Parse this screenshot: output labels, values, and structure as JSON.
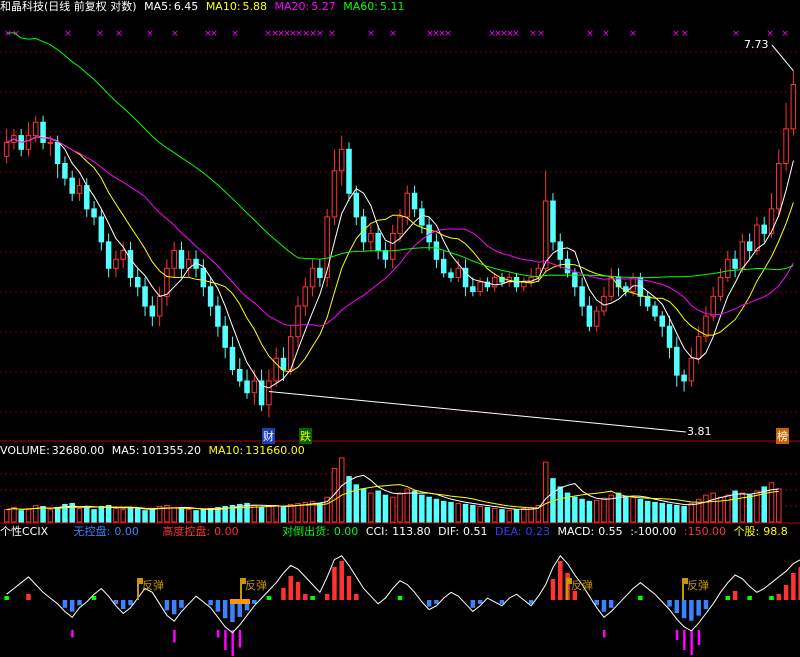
{
  "price_header": {
    "title": "和晶科技(日线 前复权 对数)",
    "ma5_label": "MA5:",
    "ma5_value": "6.45",
    "ma10_label": "MA10:",
    "ma10_value": "5.88",
    "ma20_label": "MA20:",
    "ma20_value": "5.27",
    "ma60_label": "MA60:",
    "ma60_value": "5.11"
  },
  "volume_header": {
    "volume_label": "VOLUME:",
    "volume_value": "32680.00",
    "ma5_label": "MA5:",
    "ma5_value": "101355.20",
    "ma10_label": "MA10:",
    "ma10_value": "131660.00"
  },
  "indicator_header": {
    "name": "个性CCIX",
    "no_control_label": "无控盘:",
    "no_control_value": "0.00",
    "high_control_label": "高度控盘:",
    "high_control_value": "0.00",
    "dump_label": "对倒出货:",
    "dump_value": "0.00",
    "cci_label": "CCI:",
    "cci_value": "113.80",
    "dif_label": "DIF:",
    "dif_value": "0.51",
    "dea_label": "DEA:",
    "dea_value": "0.23",
    "macd_label": "MACD:",
    "macd_value": "0.55",
    "neg100": ":-100.00",
    "pos150": ":150.00",
    "stock_label": "个股:",
    "stock_value": "98.8"
  },
  "annotations": {
    "high_price": "7.73",
    "low_price": "3.81",
    "tag_cai": "财",
    "tag_die": "跌",
    "tag_bang": "榜",
    "rebound": "反弹"
  },
  "colors": {
    "up": "#ff3232",
    "down": "#54ffff",
    "ma5": "#ffffff",
    "ma10": "#ffff00",
    "ma20": "#ff00ff",
    "ma60": "#00ff00",
    "grid": "#800000",
    "panel_border": "#b40000",
    "rebound": "#c89600",
    "cci_line": "#ffffff",
    "neg_bar": "#3c82ff",
    "magenta_bar": "#ff00ff"
  },
  "chart_data": [
    {
      "type": "candlestick",
      "title": "和晶科技(日线 前复权 对数)",
      "ylabel": "",
      "ylim": [
        3.5,
        8.2
      ],
      "log_scale": true,
      "annotations": {
        "high": 7.73,
        "low": 3.81
      },
      "series": [
        {
          "name": "MA5",
          "last": 6.45
        },
        {
          "name": "MA10",
          "last": 5.88
        },
        {
          "name": "MA20",
          "last": 5.27
        },
        {
          "name": "MA60",
          "last": 5.11
        }
      ],
      "candles": [
        [
          6.4,
          6.6,
          6.8,
          6.3
        ],
        [
          6.6,
          6.7,
          6.8,
          6.5
        ],
        [
          6.7,
          6.5,
          6.8,
          6.4
        ],
        [
          6.5,
          6.7,
          6.9,
          6.4
        ],
        [
          6.7,
          6.9,
          7.0,
          6.6
        ],
        [
          6.9,
          6.6,
          7.0,
          6.5
        ],
        [
          6.6,
          6.6,
          6.7,
          6.4
        ],
        [
          6.6,
          6.3,
          6.7,
          6.1
        ],
        [
          6.3,
          6.1,
          6.4,
          6.0
        ],
        [
          6.1,
          5.9,
          6.2,
          5.8
        ],
        [
          5.9,
          6.0,
          6.1,
          5.8
        ],
        [
          6.0,
          5.7,
          6.1,
          5.6
        ],
        [
          5.7,
          5.6,
          5.8,
          5.5
        ],
        [
          5.6,
          5.3,
          5.7,
          5.2
        ],
        [
          5.3,
          5.0,
          5.4,
          4.9
        ],
        [
          5.0,
          5.1,
          5.2,
          4.9
        ],
        [
          5.1,
          5.2,
          5.3,
          5.0
        ],
        [
          5.2,
          4.9,
          5.3,
          4.8
        ],
        [
          4.9,
          4.8,
          5.0,
          4.7
        ],
        [
          4.8,
          4.6,
          4.9,
          4.5
        ],
        [
          4.6,
          4.5,
          4.7,
          4.4
        ],
        [
          4.5,
          4.7,
          4.8,
          4.4
        ],
        [
          4.7,
          5.0,
          5.1,
          4.6
        ],
        [
          5.0,
          5.2,
          5.3,
          4.9
        ],
        [
          5.2,
          5.0,
          5.3,
          4.9
        ],
        [
          5.0,
          5.1,
          5.2,
          4.9
        ],
        [
          5.1,
          5.0,
          5.2,
          4.9
        ],
        [
          5.0,
          4.8,
          5.1,
          4.7
        ],
        [
          4.8,
          4.6,
          4.9,
          4.5
        ],
        [
          4.6,
          4.4,
          4.7,
          4.3
        ],
        [
          4.4,
          4.2,
          4.5,
          4.1
        ],
        [
          4.2,
          4.0,
          4.3,
          3.95
        ],
        [
          4.0,
          3.9,
          4.1,
          3.85
        ],
        [
          3.9,
          3.8,
          4.0,
          3.75
        ],
        [
          3.8,
          3.9,
          4.0,
          3.7
        ],
        [
          3.9,
          3.7,
          4.0,
          3.65
        ],
        [
          3.7,
          3.9,
          4.0,
          3.6
        ],
        [
          3.9,
          4.1,
          4.2,
          3.85
        ],
        [
          4.1,
          4.0,
          4.2,
          3.9
        ],
        [
          4.0,
          4.3,
          4.4,
          3.95
        ],
        [
          4.3,
          4.6,
          4.7,
          4.2
        ],
        [
          4.6,
          4.8,
          4.9,
          4.5
        ],
        [
          4.8,
          5.0,
          5.1,
          4.7
        ],
        [
          5.0,
          4.9,
          5.1,
          4.8
        ],
        [
          4.9,
          5.6,
          5.7,
          4.8
        ],
        [
          5.6,
          6.2,
          6.5,
          5.5
        ],
        [
          6.2,
          6.5,
          6.7,
          6.0
        ],
        [
          6.5,
          5.9,
          6.6,
          5.8
        ],
        [
          5.9,
          5.6,
          6.0,
          5.5
        ],
        [
          5.6,
          5.3,
          5.7,
          5.2
        ],
        [
          5.3,
          5.4,
          5.5,
          5.2
        ],
        [
          5.4,
          5.2,
          5.5,
          5.1
        ],
        [
          5.2,
          5.1,
          5.3,
          5.0
        ],
        [
          5.1,
          5.4,
          5.5,
          5.0
        ],
        [
          5.4,
          5.6,
          5.7,
          5.3
        ],
        [
          5.6,
          5.9,
          6.0,
          5.5
        ],
        [
          5.9,
          5.7,
          6.0,
          5.6
        ],
        [
          5.7,
          5.5,
          5.8,
          5.4
        ],
        [
          5.5,
          5.3,
          5.6,
          5.2
        ],
        [
          5.3,
          5.1,
          5.4,
          5.0
        ],
        [
          5.1,
          4.95,
          5.2,
          4.9
        ],
        [
          4.95,
          4.9,
          5.0,
          4.85
        ],
        [
          4.9,
          5.0,
          5.1,
          4.85
        ],
        [
          5.0,
          4.8,
          5.1,
          4.7
        ],
        [
          4.8,
          4.75,
          4.9,
          4.7
        ],
        [
          4.75,
          4.85,
          4.9,
          4.7
        ],
        [
          4.85,
          4.8,
          4.9,
          4.75
        ],
        [
          4.8,
          4.9,
          4.95,
          4.75
        ],
        [
          4.9,
          4.85,
          4.95,
          4.8
        ],
        [
          4.85,
          4.9,
          4.95,
          4.8
        ],
        [
          4.9,
          4.8,
          4.95,
          4.75
        ],
        [
          4.8,
          4.85,
          4.9,
          4.75
        ],
        [
          4.85,
          4.9,
          5.0,
          4.8
        ],
        [
          4.9,
          5.0,
          5.05,
          4.85
        ],
        [
          5.0,
          5.8,
          6.2,
          4.95
        ],
        [
          5.8,
          5.3,
          5.9,
          5.2
        ],
        [
          5.3,
          5.1,
          5.4,
          5.0
        ],
        [
          5.1,
          4.95,
          5.2,
          4.9
        ],
        [
          4.95,
          4.8,
          5.0,
          4.7
        ],
        [
          4.8,
          4.6,
          4.9,
          4.5
        ],
        [
          4.6,
          4.4,
          4.7,
          4.35
        ],
        [
          4.4,
          4.55,
          4.6,
          4.35
        ],
        [
          4.55,
          4.7,
          4.8,
          4.5
        ],
        [
          4.7,
          4.9,
          5.0,
          4.65
        ],
        [
          4.9,
          4.8,
          5.0,
          4.7
        ],
        [
          4.8,
          4.75,
          4.85,
          4.7
        ],
        [
          4.75,
          4.9,
          4.95,
          4.7
        ],
        [
          4.9,
          4.7,
          4.95,
          4.6
        ],
        [
          4.7,
          4.6,
          4.75,
          4.55
        ],
        [
          4.6,
          4.5,
          4.65,
          4.45
        ],
        [
          4.5,
          4.4,
          4.55,
          4.3
        ],
        [
          4.4,
          4.2,
          4.5,
          4.1
        ],
        [
          4.2,
          3.95,
          4.3,
          3.85
        ],
        [
          3.95,
          3.9,
          4.0,
          3.81
        ],
        [
          3.9,
          4.1,
          4.2,
          3.85
        ],
        [
          4.1,
          4.3,
          4.4,
          4.05
        ],
        [
          4.3,
          4.5,
          4.6,
          4.25
        ],
        [
          4.5,
          4.7,
          4.8,
          4.45
        ],
        [
          4.7,
          4.9,
          5.0,
          4.65
        ],
        [
          4.9,
          5.1,
          5.2,
          4.85
        ],
        [
          5.1,
          5.0,
          5.2,
          4.9
        ],
        [
          5.0,
          5.3,
          5.4,
          4.95
        ],
        [
          5.3,
          5.2,
          5.4,
          5.1
        ],
        [
          5.2,
          5.5,
          5.6,
          5.15
        ],
        [
          5.5,
          5.4,
          5.6,
          5.3
        ],
        [
          5.4,
          5.7,
          5.9,
          5.35
        ],
        [
          5.7,
          6.3,
          6.5,
          5.6
        ],
        [
          6.3,
          6.8,
          7.2,
          6.2
        ],
        [
          6.8,
          7.5,
          7.73,
          6.7
        ]
      ]
    },
    {
      "type": "bar",
      "title": "VOLUME",
      "series": [
        {
          "name": "VOLUME",
          "last": 32680.0
        },
        {
          "name": "MA5",
          "last": 101355.2
        },
        {
          "name": "MA10",
          "last": 131660.0
        }
      ],
      "values": [
        60,
        70,
        55,
        65,
        80,
        75,
        60,
        70,
        85,
        90,
        65,
        70,
        60,
        75,
        80,
        65,
        60,
        70,
        65,
        55,
        60,
        75,
        80,
        70,
        65,
        60,
        55,
        60,
        65,
        70,
        75,
        80,
        85,
        90,
        80,
        70,
        75,
        80,
        70,
        85,
        90,
        95,
        100,
        90,
        120,
        260,
        310,
        220,
        180,
        160,
        140,
        150,
        130,
        120,
        140,
        160,
        150,
        130,
        120,
        110,
        100,
        95,
        90,
        85,
        80,
        75,
        70,
        65,
        60,
        55,
        60,
        65,
        70,
        80,
        290,
        210,
        170,
        140,
        120,
        110,
        100,
        105,
        115,
        130,
        140,
        125,
        120,
        110,
        100,
        95,
        90,
        85,
        80,
        75,
        90,
        110,
        130,
        140,
        120,
        130,
        150,
        140,
        130,
        150,
        170,
        190,
        160
      ]
    },
    {
      "type": "line",
      "title": "个性CCIX",
      "series": [
        {
          "name": "CCI",
          "last": 113.8
        },
        {
          "name": "DIF",
          "last": 0.51
        },
        {
          "name": "DEA",
          "last": 0.23
        },
        {
          "name": "MACD",
          "last": 0.55
        }
      ],
      "levels": [
        -100,
        150
      ],
      "cci": [
        30,
        60,
        90,
        120,
        80,
        40,
        10,
        -20,
        -60,
        -90,
        -40,
        -10,
        30,
        60,
        20,
        -30,
        -70,
        -40,
        10,
        60,
        40,
        -20,
        -80,
        -110,
        -60,
        -20,
        20,
        -10,
        -40,
        -90,
        -140,
        -170,
        -130,
        -80,
        -30,
        10,
        50,
        90,
        140,
        180,
        160,
        120,
        80,
        40,
        120,
        210,
        230,
        180,
        120,
        60,
        20,
        -20,
        10,
        60,
        100,
        80,
        40,
        -10,
        -50,
        -30,
        10,
        40,
        20,
        -20,
        -60,
        -30,
        10,
        -10,
        -30,
        10,
        30,
        0,
        -30,
        20,
        80,
        170,
        230,
        190,
        130,
        80,
        20,
        -40,
        -90,
        -60,
        -20,
        20,
        60,
        90,
        60,
        30,
        -10,
        -50,
        -100,
        -140,
        -160,
        -120,
        -70,
        -20,
        40,
        90,
        130,
        110,
        70,
        40,
        60,
        90,
        120,
        150,
        190,
        210,
        170,
        113.8
      ]
    }
  ]
}
